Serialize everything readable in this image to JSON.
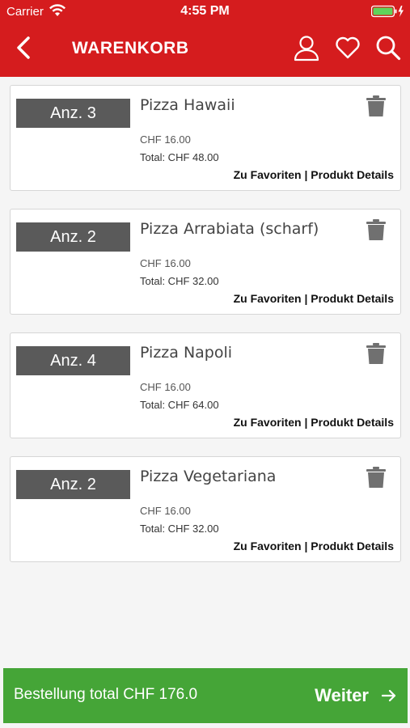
{
  "status_bar": {
    "carrier": "Carrier",
    "time": "4:55 PM"
  },
  "navbar": {
    "title": "WARENKORB"
  },
  "cart": {
    "items": [
      {
        "qty_label": "Anz. 3",
        "name": "Pizza Hawaii",
        "unit_price": "CHF 16.00",
        "total": "Total: CHF 48.00"
      },
      {
        "qty_label": "Anz. 2",
        "name": "Pizza Arrabiata (scharf)",
        "unit_price": "CHF 16.00",
        "total": "Total: CHF 32.00"
      },
      {
        "qty_label": "Anz. 4",
        "name": "Pizza Napoli",
        "unit_price": "CHF 16.00",
        "total": "Total: CHF 64.00"
      },
      {
        "qty_label": "Anz. 2",
        "name": "Pizza Vegetariana",
        "unit_price": "CHF 16.00",
        "total": "Total: CHF 32.00"
      }
    ],
    "favorites_label": "Zu Favoriten",
    "separator": " | ",
    "details_label": "Produkt Details"
  },
  "footer": {
    "order_total": "Bestellung total CHF 176.0",
    "next_label": "Weiter"
  },
  "colors": {
    "header": "#d51c1e",
    "footer": "#45a537",
    "qty_badge": "#5a5a5a"
  }
}
